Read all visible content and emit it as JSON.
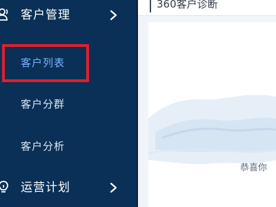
{
  "sidebar": {
    "groups": [
      {
        "label": "客户管理",
        "icon": "users-icon"
      },
      {
        "label": "运营计划",
        "icon": "lightbulb-icon"
      }
    ],
    "sub_items": [
      {
        "label": "客户列表",
        "active": true
      },
      {
        "label": "客户分群",
        "active": false
      },
      {
        "label": "客户分析",
        "active": false
      }
    ]
  },
  "main": {
    "title": "360客户诊断",
    "message": "恭喜你"
  },
  "colors": {
    "sidebar_bg": "#0b3057",
    "active_text": "#78b4ff",
    "highlight": "#e0202a",
    "illustration": "#cfe0f0"
  }
}
